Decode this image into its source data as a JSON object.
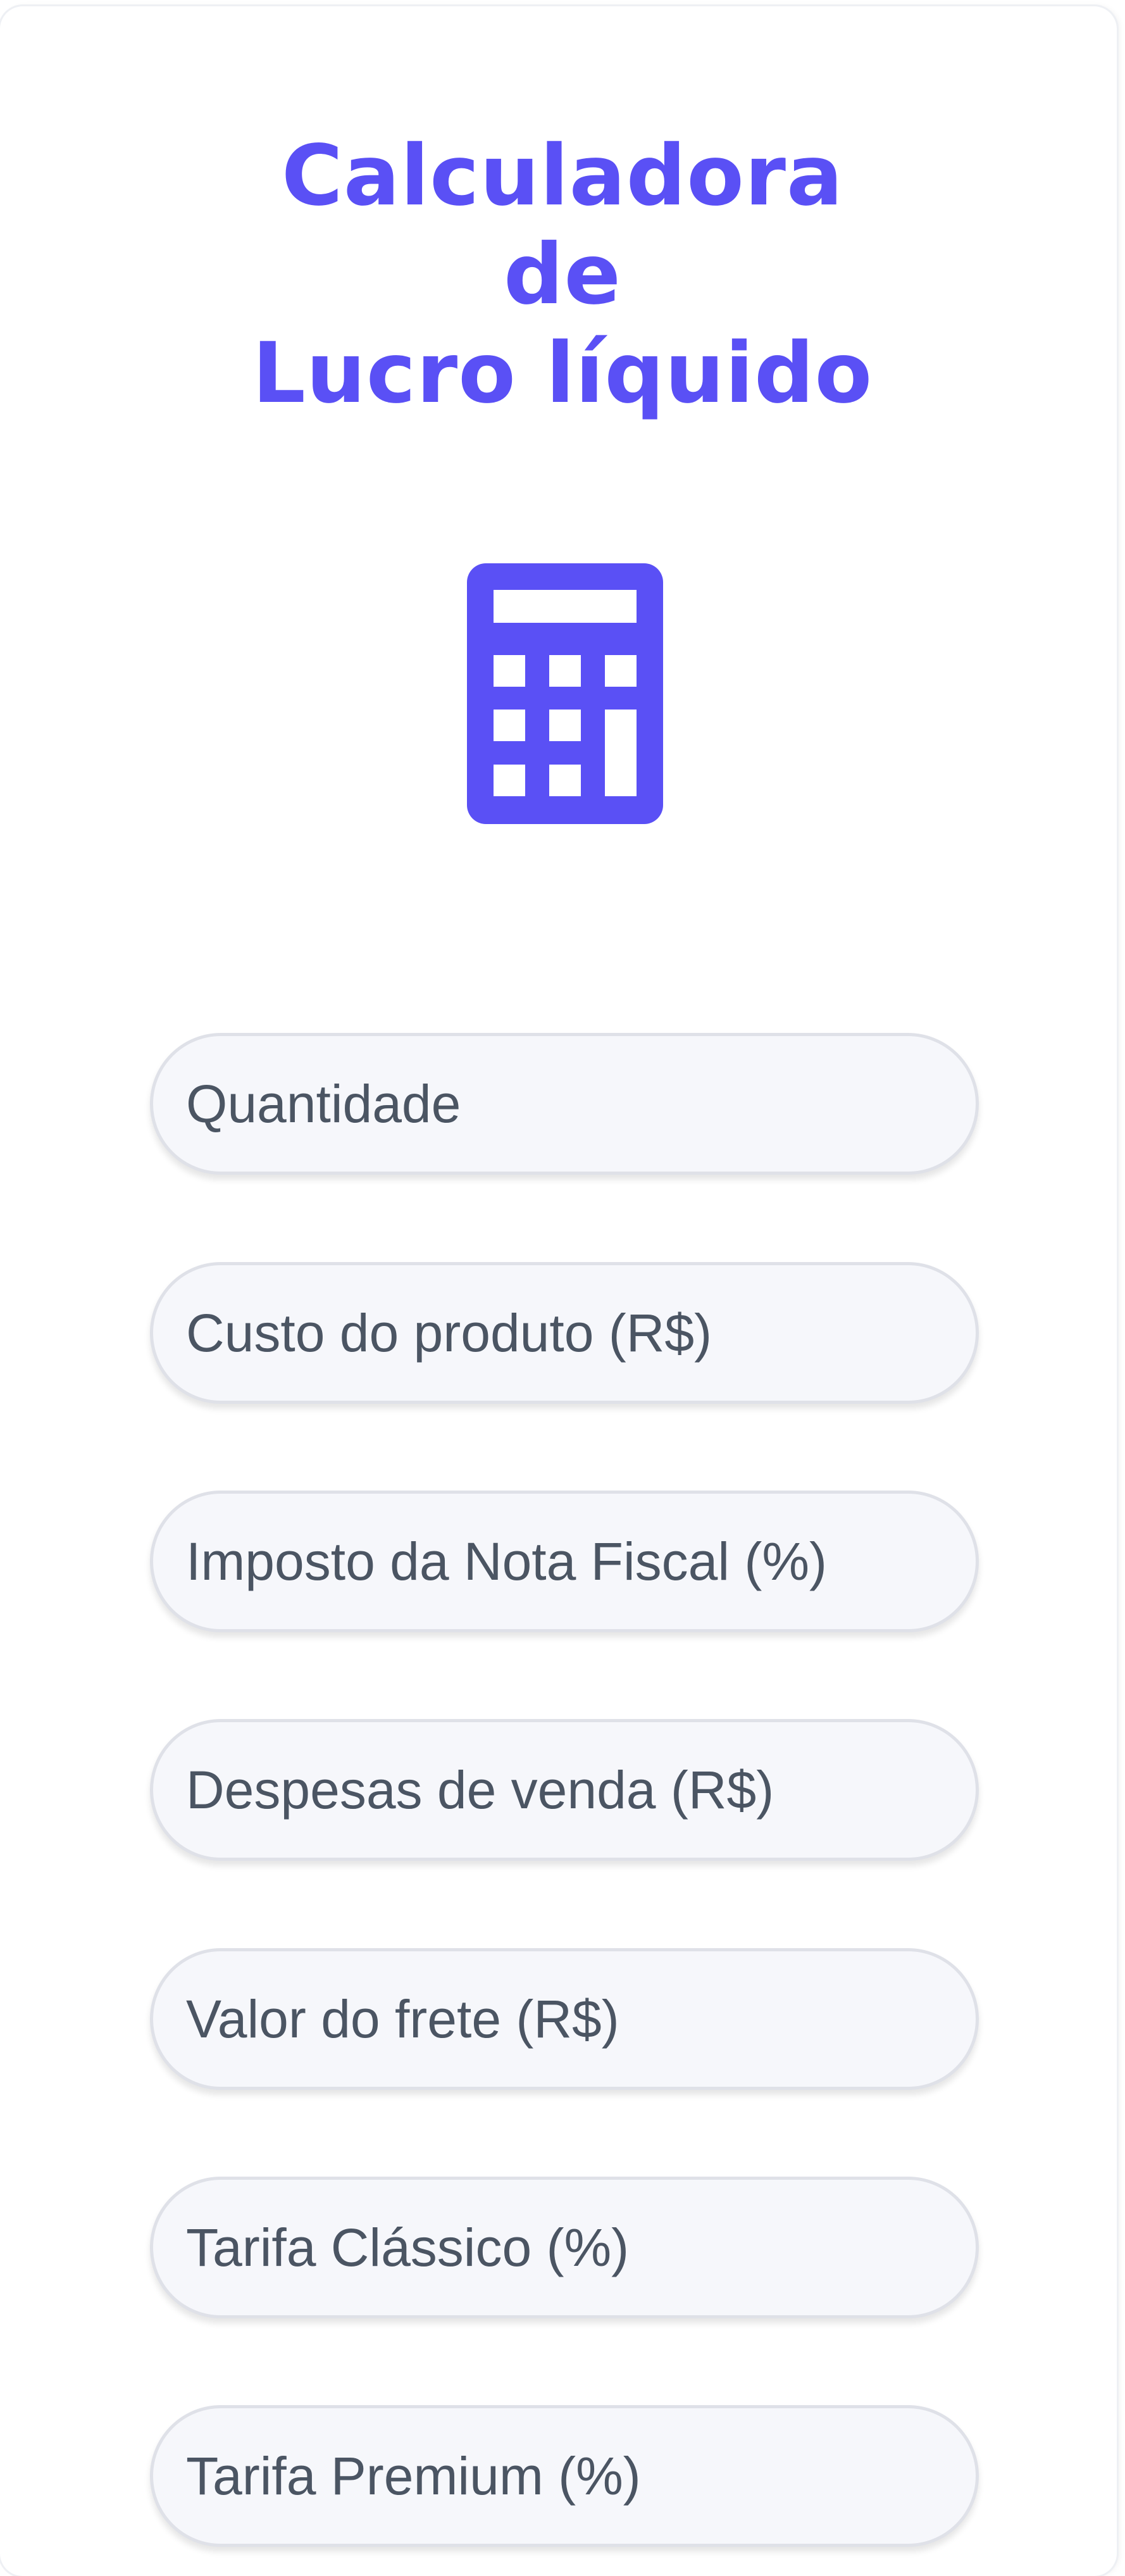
{
  "header": {
    "title_line1": "Calculadora",
    "title_line2": "de",
    "title_line3": "Lucro líquido",
    "icon": "calculator-icon",
    "accent_color": "#5a50f5"
  },
  "form": {
    "fields": [
      {
        "placeholder": "Quantidade"
      },
      {
        "placeholder": "Custo do produto (R$)"
      },
      {
        "placeholder": "Imposto da Nota Fiscal (%)"
      },
      {
        "placeholder": "Despesas de venda (R$)"
      },
      {
        "placeholder": "Valor do frete (R$)"
      },
      {
        "placeholder": "Tarifa Clássico (%)"
      },
      {
        "placeholder": "Tarifa Premium (%)"
      }
    ]
  }
}
